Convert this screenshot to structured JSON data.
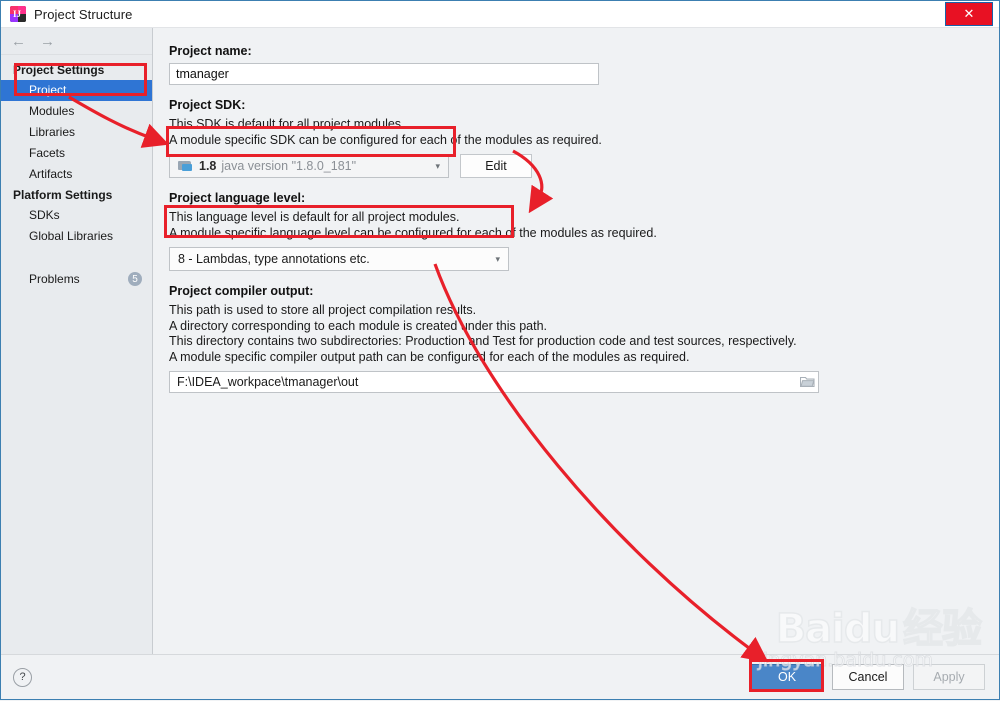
{
  "window": {
    "title": "Project Structure",
    "app_icon": "intellij-idea-icon",
    "close_label": "✕"
  },
  "nav": {
    "back_icon": "←",
    "forward_icon": "→"
  },
  "sidebar": {
    "groups": [
      {
        "label": "Project Settings",
        "items": [
          {
            "label": "Project",
            "selected": true
          },
          {
            "label": "Modules",
            "selected": false
          },
          {
            "label": "Libraries",
            "selected": false
          },
          {
            "label": "Facets",
            "selected": false
          },
          {
            "label": "Artifacts",
            "selected": false
          }
        ]
      },
      {
        "label": "Platform Settings",
        "items": [
          {
            "label": "SDKs",
            "selected": false
          },
          {
            "label": "Global Libraries",
            "selected": false
          }
        ]
      }
    ],
    "problems": {
      "label": "Problems",
      "count": "5"
    }
  },
  "main": {
    "project_name": {
      "label": "Project name:",
      "value": "tmanager"
    },
    "project_sdk": {
      "label": "Project SDK:",
      "desc_line1": "This SDK is default for all project modules.",
      "desc_line2": "A module specific SDK can be configured for each of the modules as required.",
      "selected_version": "1.8",
      "selected_detail": "java version \"1.8.0_181\"",
      "caret": "▾",
      "edit_label": "Edit"
    },
    "language_level": {
      "label": "Project language level:",
      "desc_line1": "This language level is default for all project modules.",
      "desc_line2": "A module specific language level can be configured for each of the modules as required.",
      "selected": "8 - Lambdas, type annotations etc.",
      "caret": "▾"
    },
    "compiler_output": {
      "label": "Project compiler output:",
      "desc_line1": "This path is used to store all project compilation results.",
      "desc_line2": "A directory corresponding to each module is created under this path.",
      "desc_line3": "This directory contains two subdirectories: Production and Test for production code and test sources, respectively.",
      "desc_line4": "A module specific compiler output path can be configured for each of the modules as required.",
      "value": "F:\\IDEA_workpace\\tmanager\\out",
      "browse_icon": "folder-icon"
    }
  },
  "footer": {
    "help_label": "?",
    "ok_label": "OK",
    "cancel_label": "Cancel",
    "apply_label": "Apply"
  },
  "watermark": {
    "brand": "Baidu",
    "brand_cn": "经验",
    "url": "jingyan.baidu.com"
  },
  "annotations": {
    "accent_color": "#e8202a"
  }
}
